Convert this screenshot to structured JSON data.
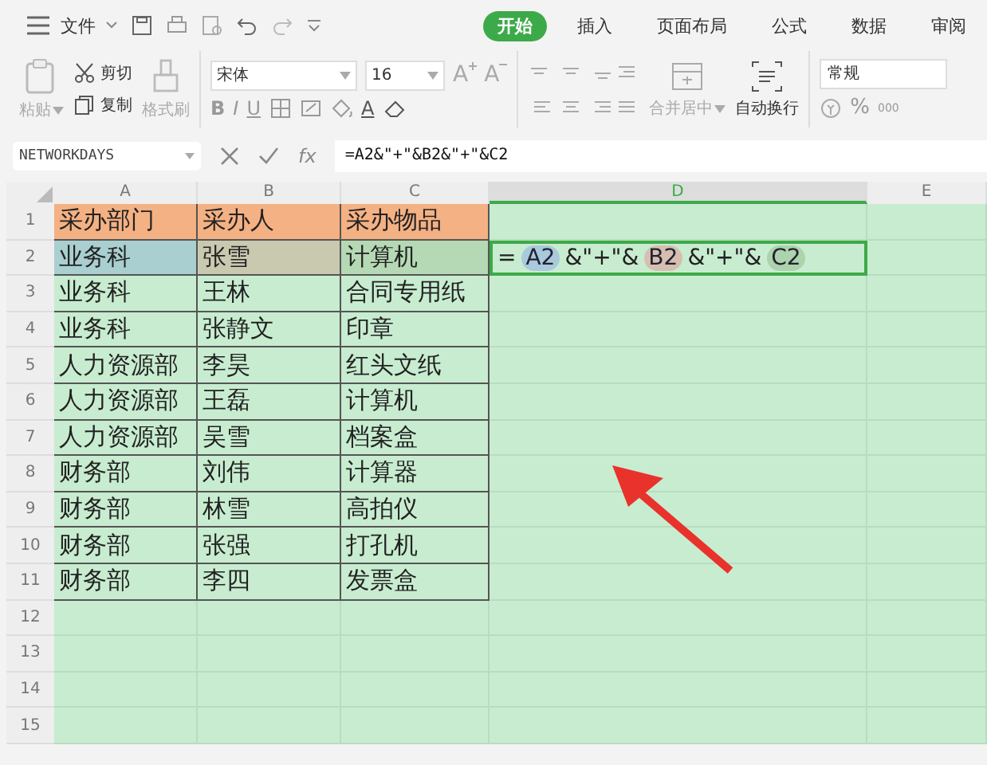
{
  "menu": {
    "label": "文件"
  },
  "tabs": [
    {
      "label": "开始",
      "selected": true
    },
    {
      "label": "插入",
      "selected": false
    },
    {
      "label": "页面布局",
      "selected": false
    },
    {
      "label": "公式",
      "selected": false
    },
    {
      "label": "数据",
      "selected": false
    },
    {
      "label": "审阅",
      "selected": false
    }
  ],
  "ribbon": {
    "paste": "粘贴",
    "cut": "剪切",
    "copy": "复制",
    "format_painter": "格式刷",
    "font": "宋体",
    "size": "16",
    "grow": "A",
    "shrink": "A",
    "bold": "B",
    "italic": "I",
    "underline": "U",
    "font_color": "A",
    "merge": "合并居中",
    "wrap": "自动换行",
    "number_format": "常规",
    "percent": "%",
    "thousands": "000"
  },
  "formula_bar": {
    "name_box": "NETWORKDAYS",
    "fx": "fx",
    "formula": "=A2&\"+\"&B2&\"+\"&C2"
  },
  "columns": [
    {
      "label": "A",
      "selected": false
    },
    {
      "label": "B",
      "selected": false
    },
    {
      "label": "C",
      "selected": false
    },
    {
      "label": "D",
      "selected": true
    },
    {
      "label": "E",
      "selected": false
    }
  ],
  "rows": [
    {
      "number": "1",
      "kind": "header",
      "cells": [
        {
          "text": "采办部门"
        },
        {
          "text": "采办人"
        },
        {
          "text": "采办物品"
        }
      ]
    },
    {
      "number": "2",
      "kind": "editing",
      "cells": [
        {
          "text": "业务科",
          "color": "#a9cfd0"
        },
        {
          "text": "张雪",
          "color": "#c9c9b0"
        },
        {
          "text": "计算机",
          "color": "#b5d9b5"
        }
      ],
      "formula": [
        {
          "text": "=",
          "kind": "plain"
        },
        {
          "text": "A2",
          "kind": "ref",
          "color": "#a9c9dc"
        },
        {
          "text": "&\"+\"&",
          "kind": "plain"
        },
        {
          "text": "B2",
          "kind": "ref",
          "color": "#d6bfb0"
        },
        {
          "text": "&\"+\"&",
          "kind": "plain"
        },
        {
          "text": "C2",
          "kind": "ref",
          "color": "#acd3ac"
        }
      ]
    },
    {
      "number": "3",
      "kind": "data",
      "cells": [
        {
          "text": "业务科"
        },
        {
          "text": "王林"
        },
        {
          "text": "合同专用纸"
        }
      ]
    },
    {
      "number": "4",
      "kind": "data",
      "cells": [
        {
          "text": "业务科"
        },
        {
          "text": "张静文"
        },
        {
          "text": "印章"
        }
      ]
    },
    {
      "number": "5",
      "kind": "data",
      "cells": [
        {
          "text": "人力资源部"
        },
        {
          "text": "李昊"
        },
        {
          "text": "红头文纸"
        }
      ]
    },
    {
      "number": "6",
      "kind": "data",
      "cells": [
        {
          "text": "人力资源部"
        },
        {
          "text": "王磊"
        },
        {
          "text": "计算机"
        }
      ]
    },
    {
      "number": "7",
      "kind": "data",
      "cells": [
        {
          "text": "人力资源部"
        },
        {
          "text": "吴雪"
        },
        {
          "text": "档案盒"
        }
      ]
    },
    {
      "number": "8",
      "kind": "data",
      "cells": [
        {
          "text": "财务部"
        },
        {
          "text": "刘伟"
        },
        {
          "text": "计算器"
        }
      ]
    },
    {
      "number": "9",
      "kind": "data",
      "cells": [
        {
          "text": "财务部"
        },
        {
          "text": "林雪"
        },
        {
          "text": "高拍仪"
        }
      ]
    },
    {
      "number": "10",
      "kind": "data",
      "cells": [
        {
          "text": "财务部"
        },
        {
          "text": "张强"
        },
        {
          "text": "打孔机"
        }
      ]
    },
    {
      "number": "11",
      "kind": "data",
      "cells": [
        {
          "text": "财务部"
        },
        {
          "text": "李四"
        },
        {
          "text": "发票盒"
        }
      ]
    },
    {
      "number": "12",
      "kind": "empty"
    },
    {
      "number": "13",
      "kind": "empty"
    },
    {
      "number": "14",
      "kind": "empty"
    },
    {
      "number": "15",
      "kind": "empty"
    }
  ]
}
